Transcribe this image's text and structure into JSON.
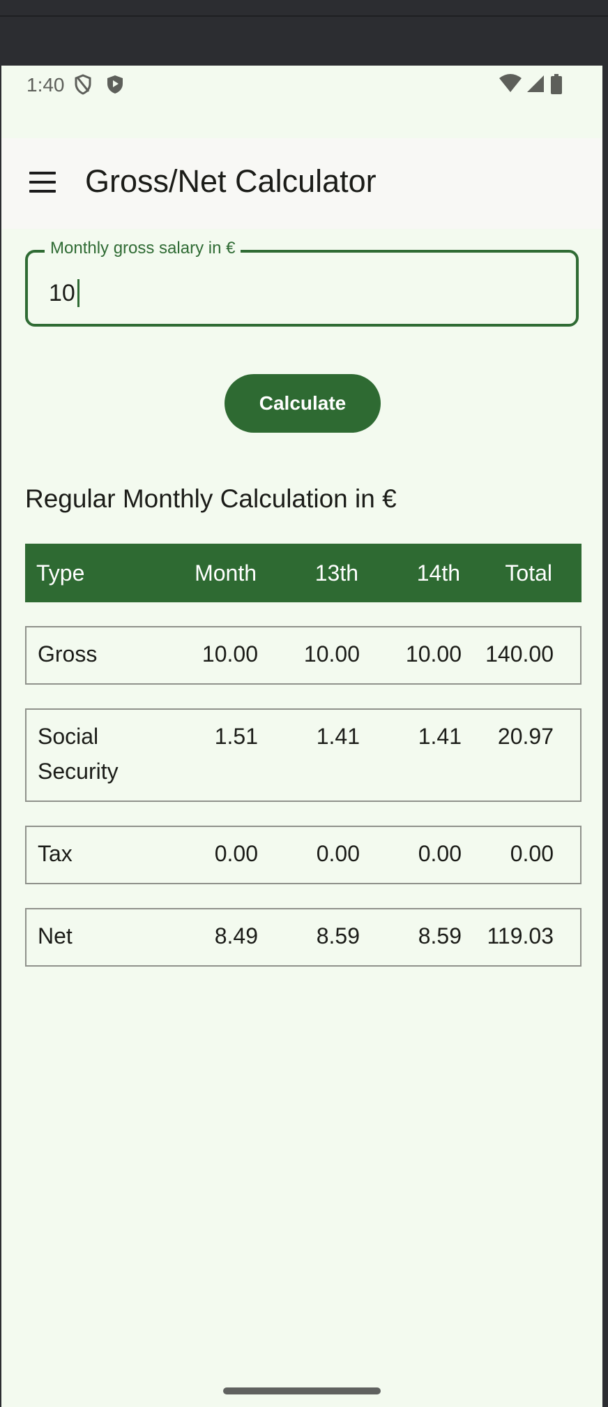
{
  "status_bar": {
    "time": "1:40"
  },
  "app_bar": {
    "title": "Gross/Net Calculator"
  },
  "form": {
    "salary_label": "Monthly gross salary in €",
    "salary_value": "10",
    "calculate_label": "Calculate"
  },
  "results": {
    "section_title": "Regular Monthly Calculation in €",
    "columns": [
      "Type",
      "Month",
      "13th",
      "14th",
      "Total"
    ],
    "rows": [
      {
        "type": "Gross",
        "month": "10.00",
        "m13": "10.00",
        "m14": "10.00",
        "total": "140.00"
      },
      {
        "type": "Social Security",
        "month": "1.51",
        "m13": "1.41",
        "m14": "1.41",
        "total": "20.97"
      },
      {
        "type": "Tax",
        "month": "0.00",
        "m13": "0.00",
        "m14": "0.00",
        "total": "0.00"
      },
      {
        "type": "Net",
        "month": "8.49",
        "m13": "8.59",
        "m14": "8.59",
        "total": "119.03"
      }
    ]
  },
  "colors": {
    "primary": "#2e6a32",
    "background": "#f3faef",
    "appbar": "#f8f8f5"
  }
}
